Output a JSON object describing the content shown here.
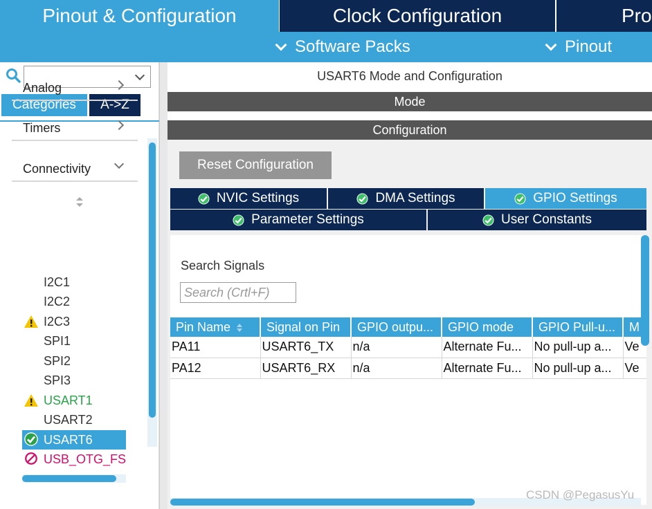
{
  "top_tabs": {
    "pinout": "Pinout & Configuration",
    "clock": "Clock Configuration",
    "project": "Pro"
  },
  "sub_bar": {
    "software_packs": "Software Packs",
    "pinout": "Pinout"
  },
  "left": {
    "search_value": "",
    "categories_label": "Categories",
    "az_label": "A->Z",
    "categories": [
      "Analog",
      "Timers",
      "Connectivity"
    ],
    "peripherals": [
      {
        "label": "I2C1",
        "status": "none"
      },
      {
        "label": "I2C2",
        "status": "none"
      },
      {
        "label": "I2C3",
        "status": "warning"
      },
      {
        "label": "SPI1",
        "status": "none"
      },
      {
        "label": "SPI2",
        "status": "none"
      },
      {
        "label": "SPI3",
        "status": "none"
      },
      {
        "label": "USART1",
        "status": "warning"
      },
      {
        "label": "USART2",
        "status": "none"
      },
      {
        "label": "USART6",
        "status": "ok-selected"
      },
      {
        "label": "USB_OTG_FS",
        "status": "disabled"
      }
    ]
  },
  "right": {
    "title": "USART6 Mode and Configuration",
    "mode_label": "Mode",
    "configuration_label": "Configuration",
    "reset_button": "Reset Configuration",
    "tabs": {
      "nvic": "NVIC Settings",
      "dma": "DMA Settings",
      "gpio": "GPIO Settings",
      "parameter": "Parameter Settings",
      "user": "User Constants"
    },
    "search_signals_label": "Search Signals",
    "search_placeholder": "Search (Crtl+F)",
    "table": {
      "headers": [
        "Pin Name",
        "Signal on Pin",
        "GPIO outpu...",
        "GPIO mode",
        "GPIO Pull-u...",
        "M"
      ],
      "rows": [
        [
          "PA11",
          "USART6_TX",
          "n/a",
          "Alternate Fu...",
          "No pull-up a...",
          "Ve"
        ],
        [
          "PA12",
          "USART6_RX",
          "n/a",
          "Alternate Fu...",
          "No pull-up a...",
          "Ve"
        ]
      ]
    }
  },
  "watermark": "CSDN @PegasusYu",
  "colors": {
    "accent": "#3aa4d8",
    "navy": "#0b2752",
    "gray_bar": "#555555",
    "warning": "#f5c400",
    "ok": "#2aa24a",
    "disabled": "#d0106a"
  }
}
